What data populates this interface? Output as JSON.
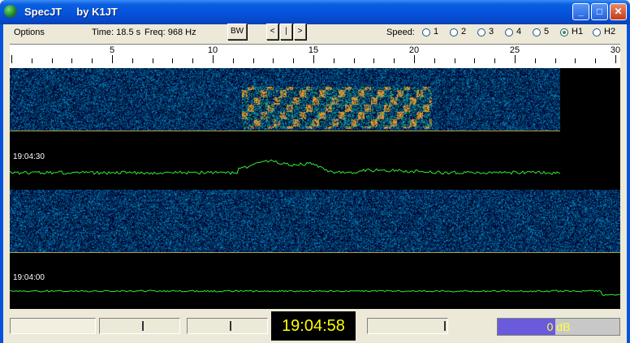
{
  "window": {
    "title": "SpecJT     by K1JT"
  },
  "toolbar": {
    "options_label": "Options",
    "time_text": "Time: 18.5 s",
    "freq_text": "Freq: 968 Hz",
    "bw_label": "BW",
    "nav_prev": "<",
    "nav_pause": "|",
    "nav_next": ">",
    "speed_label": "Speed:",
    "speed_options": [
      "1",
      "2",
      "3",
      "4",
      "5",
      "H1",
      "H2"
    ],
    "speed_selected": "H1"
  },
  "ruler": {
    "labels": [
      "5",
      "10",
      "15",
      "20",
      "25",
      "30"
    ],
    "max": 30
  },
  "waterfall": {
    "timestamps": [
      "19:04:30",
      "19:04:00"
    ],
    "accent_line_color": "#b3a13a",
    "trace_color": "#35e835"
  },
  "status": {
    "clock": "19:04:58",
    "db_value": "0",
    "db_unit": "dB",
    "db_level_fraction": 0.47
  }
}
